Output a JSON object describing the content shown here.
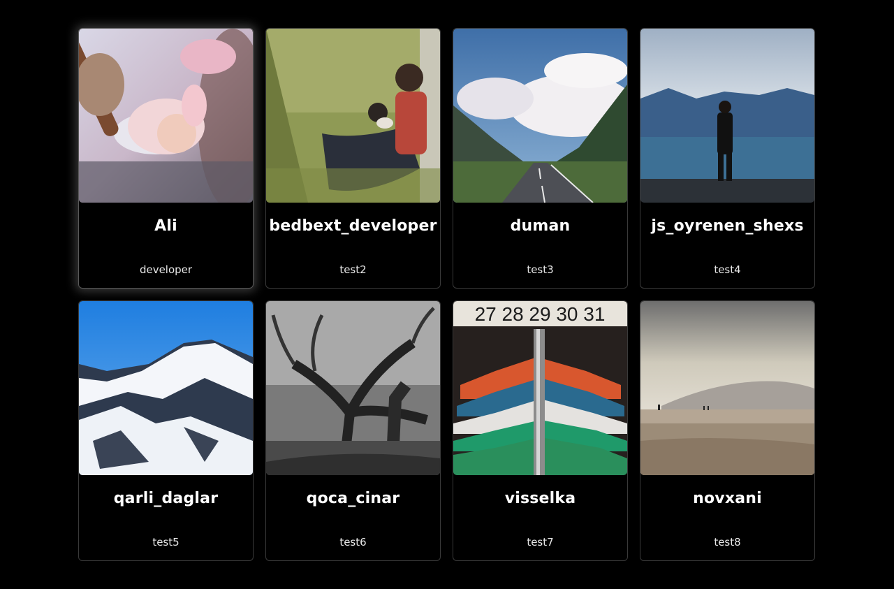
{
  "profiles": [
    {
      "name": "Ali",
      "role": "developer",
      "image": "baby-with-parent-photo"
    },
    {
      "name": "bedbext_developer",
      "role": "test2",
      "image": "man-with-dog-in-grass-photo"
    },
    {
      "name": "duman",
      "role": "test3",
      "image": "mountain-road-clouds-photo"
    },
    {
      "name": "js_oyrenen_shexs",
      "role": "test4",
      "image": "man-at-lake-photo"
    },
    {
      "name": "qarli_daglar",
      "role": "test5",
      "image": "snowy-mountains-photo"
    },
    {
      "name": "qoca_cinar",
      "role": "test6",
      "image": "old-tree-bw-photo"
    },
    {
      "name": "visselka",
      "role": "test7",
      "image": "clothes-hangers-photo"
    },
    {
      "name": "novxani",
      "role": "test8",
      "image": "beach-photo"
    }
  ],
  "hanger_numbers": "27 28 29 30 31",
  "colors": {
    "background": "#000000",
    "card_border": "#3a3a3a",
    "text": "#ffffff"
  }
}
